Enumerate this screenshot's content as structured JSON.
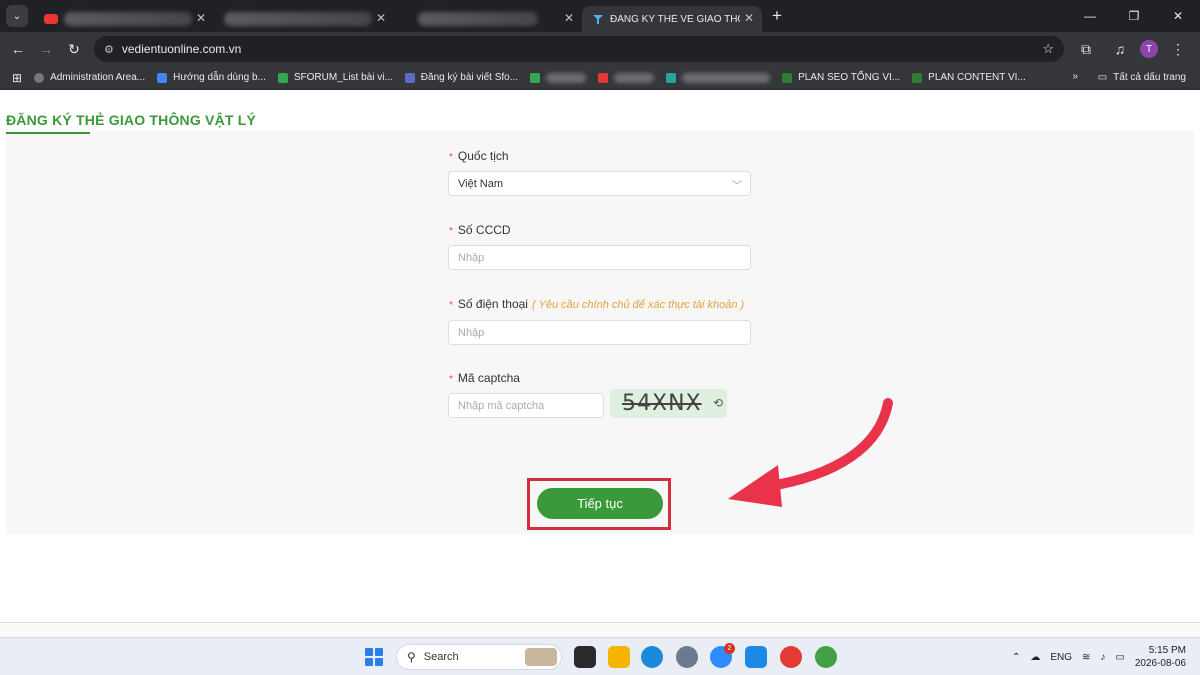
{
  "browser": {
    "tab_active_title": "ĐĂNG KÝ THẺ VÉ GIAO THÔNG",
    "new_tab_icon": "+",
    "url": "vedientuonline.com.vn",
    "profile_initial": "T"
  },
  "bookmarks": {
    "items": [
      "Administration Area...",
      "Hướng dẫn dùng b...",
      "SFORUM_List bài vi...",
      "Đăng ký bài viết Sfo...",
      "PLAN SEO TỔNG VI...",
      "PLAN CONTENT VI..."
    ],
    "more": "»",
    "all_bookmarks": "Tất cả dấu trang"
  },
  "page": {
    "title": "ĐĂNG KÝ THẺ GIAO THÔNG VẬT LÝ",
    "required_mark": "*",
    "nationality": {
      "label": "Quốc tịch",
      "value": "Việt Nam"
    },
    "id_number": {
      "label": "Số CCCD",
      "placeholder": "Nhập"
    },
    "phone": {
      "label": "Số điện thoại",
      "note": "( Yêu cầu chính chủ để xác thực tài khoản )",
      "placeholder": "Nhập"
    },
    "captcha": {
      "label": "Mã captcha",
      "placeholder": "Nhập mã captcha",
      "code": "54XNX"
    },
    "submit_label": "Tiếp tục",
    "accent_color": "#3a9a3a",
    "highlight_color": "#d32f3f"
  },
  "taskbar": {
    "search_label": "Search",
    "badge_count": "2",
    "language": "ENG",
    "time": "5:15 PM",
    "date": "2026-08-06"
  }
}
